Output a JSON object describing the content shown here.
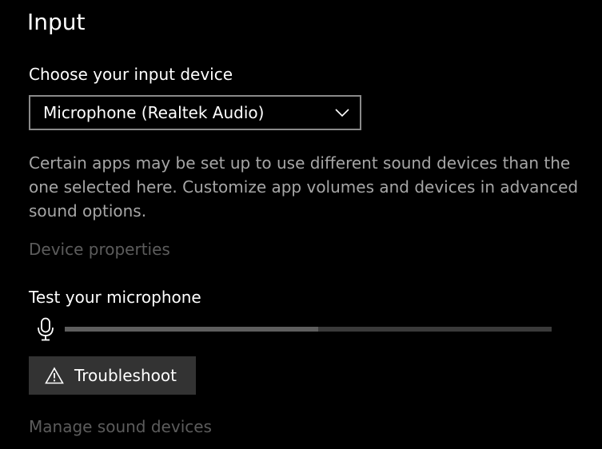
{
  "title": "Input",
  "device": {
    "label": "Choose your input device",
    "selected": "Microphone (Realtek Audio)",
    "icon": "chevron-down-icon"
  },
  "description": "Certain apps may be set up to use different sound devices than the one selected here. Customize app volumes and devices in advanced sound options.",
  "links": {
    "device_properties": "Device properties",
    "manage_devices": "Manage sound devices"
  },
  "test": {
    "label": "Test your microphone",
    "icon": "microphone-icon",
    "level_fraction": 0.52
  },
  "troubleshoot": {
    "label": "Troubleshoot",
    "icon": "warning-icon"
  },
  "colors": {
    "background": "#000000",
    "text": "#ffffff",
    "secondary_text": "#a6a6a6",
    "disabled_text": "#5c5c5c",
    "button": "#333333"
  }
}
